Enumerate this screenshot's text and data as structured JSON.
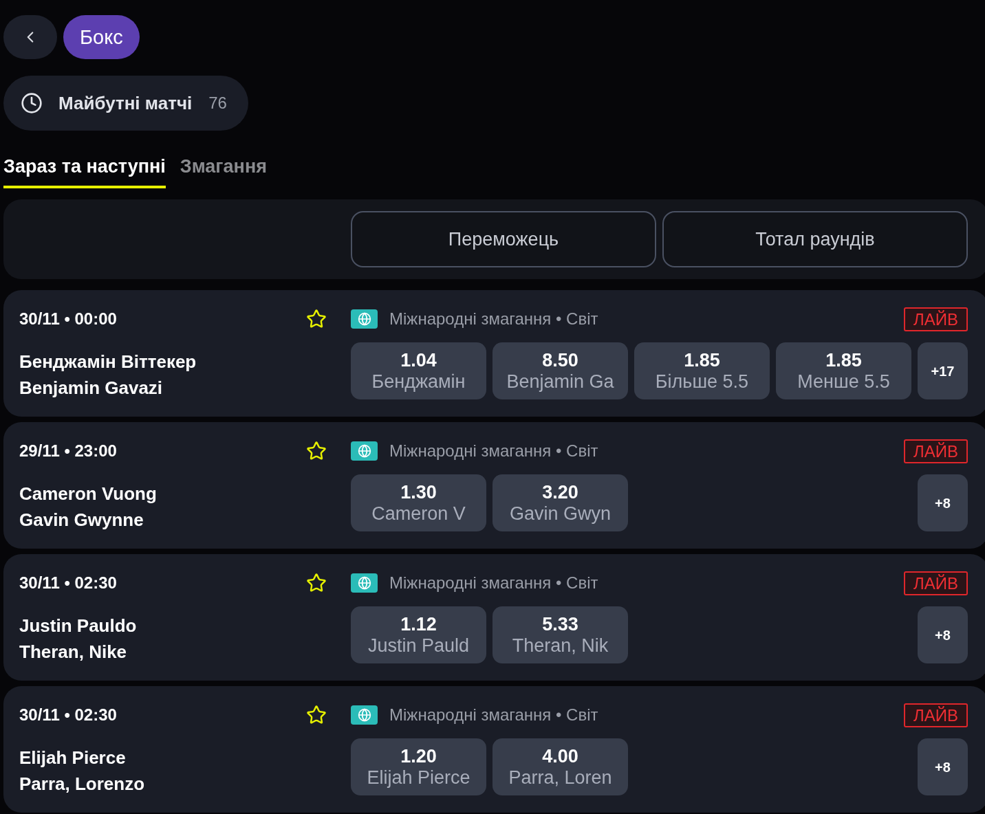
{
  "sport": "Бокс",
  "section": {
    "title": "Майбутні матчі",
    "count": "76"
  },
  "tabs": [
    {
      "label": "Зараз та наступні",
      "selected": true
    },
    {
      "label": "Змагання",
      "selected": false
    }
  ],
  "market_headers": [
    "Переможець",
    "Тотал раундів"
  ],
  "matches": [
    {
      "datetime": "30/11 • 00:00",
      "favorite": false,
      "league": "Міжнародні змагання • Світ",
      "status": "ЛАЙВ",
      "competitors": [
        "Бенджамін Віттекер",
        "Benjamin Gavazi"
      ],
      "odds": [
        {
          "value": "1.04",
          "label": "Бенджамін"
        },
        {
          "value": "8.50",
          "label": "Benjamin Ga"
        },
        {
          "value": "1.85",
          "label": "Більше 5.5"
        },
        {
          "value": "1.85",
          "label": "Менше 5.5"
        }
      ],
      "more": "+17"
    },
    {
      "datetime": "29/11 • 23:00",
      "favorite": false,
      "league": "Міжнародні змагання • Світ",
      "status": "ЛАЙВ",
      "competitors": [
        "Cameron Vuong",
        "Gavin Gwynne"
      ],
      "odds": [
        {
          "value": "1.30",
          "label": "Cameron V"
        },
        {
          "value": "3.20",
          "label": "Gavin Gwyn"
        }
      ],
      "more": "+8"
    },
    {
      "datetime": "30/11 • 02:30",
      "favorite": false,
      "league": "Міжнародні змагання • Світ",
      "status": "ЛАЙВ",
      "competitors": [
        "Justin Pauldo",
        "Theran, Nike"
      ],
      "odds": [
        {
          "value": "1.12",
          "label": "Justin Pauld"
        },
        {
          "value": "5.33",
          "label": "Theran, Nik"
        }
      ],
      "more": "+8"
    },
    {
      "datetime": "30/11 • 02:30",
      "favorite": false,
      "league": "Міжнародні змагання • Світ",
      "status": "ЛАЙВ",
      "competitors": [
        "Elijah Pierce",
        "Parra, Lorenzo"
      ],
      "odds": [
        {
          "value": "1.20",
          "label": "Elijah Pierce"
        },
        {
          "value": "4.00",
          "label": "Parra, Loren"
        }
      ],
      "more": "+8"
    }
  ]
}
